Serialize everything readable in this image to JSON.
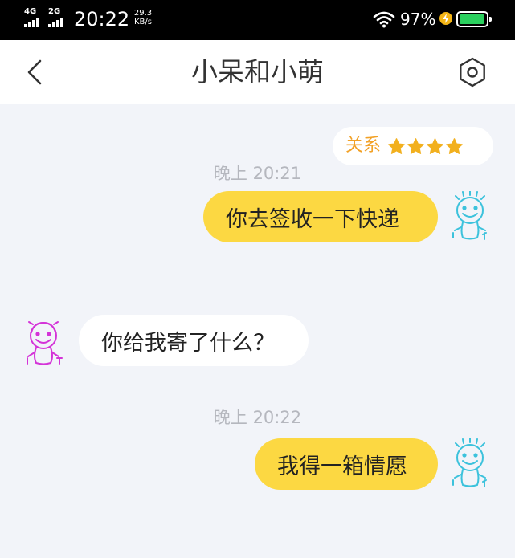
{
  "status_bar": {
    "network1": "4G",
    "network2": "2G",
    "time": "20:22",
    "speed_value": "29.3",
    "speed_unit": "KB/s",
    "battery_percent": "97%",
    "battery_level": 0.97
  },
  "header": {
    "back_icon": "chevron-left-icon",
    "title": "小呆和小萌",
    "settings_icon": "gear-icon"
  },
  "relation": {
    "label": "关系",
    "stars": 4
  },
  "messages": [
    {
      "timestamp": "晚上 20:21",
      "sender": "me",
      "text": "你去签收一下快递"
    },
    {
      "sender": "other",
      "text": "你给我寄了什么？"
    },
    {
      "timestamp": "晚上 20:22",
      "sender": "me",
      "text": "我得一箱情愿"
    }
  ],
  "colors": {
    "accent_yellow": "#fcd842",
    "star": "#f2b01e",
    "me_avatar": "#3cc2dc",
    "other_avatar": "#d433d8"
  }
}
